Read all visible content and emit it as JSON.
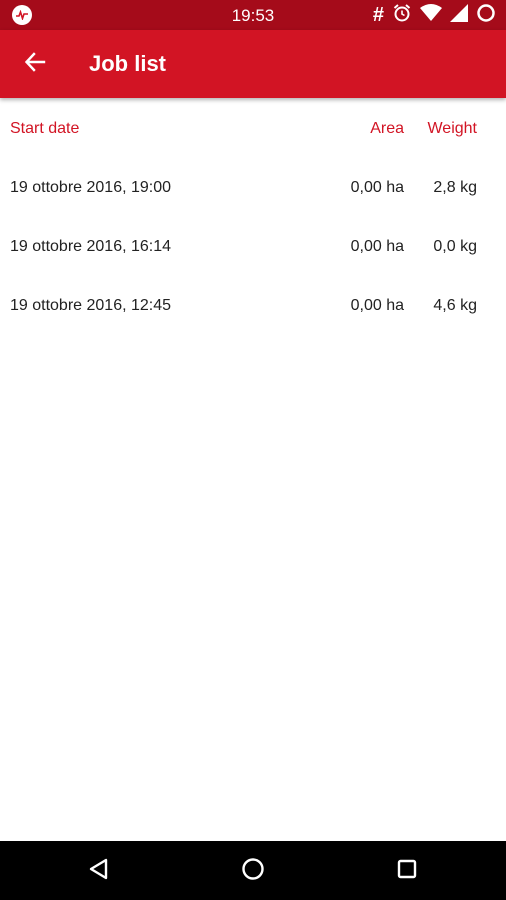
{
  "status_bar": {
    "time": "19:53",
    "icons": [
      "app-logo-icon",
      "hashtag-icon",
      "alarm-icon",
      "wifi-icon",
      "signal-icon",
      "circle-icon"
    ],
    "hash_glyph": "#"
  },
  "app_bar": {
    "title": "Job list",
    "back_icon": "arrow-left-icon"
  },
  "table": {
    "columns": [
      "Start date",
      "Area",
      "Weight"
    ],
    "rows": [
      {
        "start_date": "19 ottobre 2016, 19:00",
        "area": "0,00 ha",
        "weight": "2,8 kg"
      },
      {
        "start_date": "19 ottobre 2016, 16:14",
        "area": "0,00 ha",
        "weight": "0,0 kg"
      },
      {
        "start_date": "19 ottobre 2016, 12:45",
        "area": "0,00 ha",
        "weight": "4,6 kg"
      }
    ]
  },
  "nav_bar": {
    "icons": [
      "back-triangle-icon",
      "home-circle-icon",
      "recents-square-icon"
    ]
  },
  "colors": {
    "status_bar": "#a50b1a",
    "app_bar": "#d21424",
    "accent_text": "#d21424",
    "nav_bar": "#000000"
  }
}
